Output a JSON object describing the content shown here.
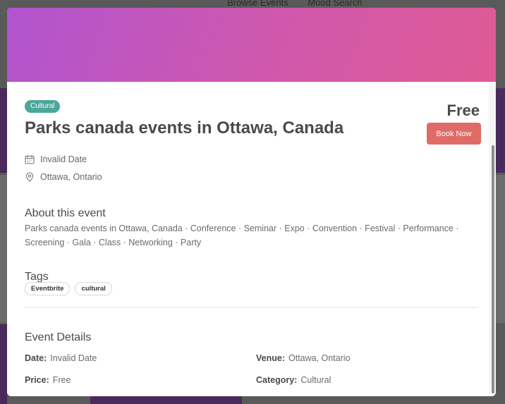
{
  "background": {
    "nav_items": [
      "Browse Events",
      "Mood Search"
    ]
  },
  "modal": {
    "category_badge": "Cultural",
    "title": "Parks canada events in Ottawa, Canada",
    "price": "Free",
    "book_button": "Book Now",
    "date": "Invalid Date",
    "location": "Ottawa, Ontario",
    "about_heading": "About this event",
    "about_text": "Parks canada events in Ottawa, Canada · Conference · Seminar · Expo · Convention · Festival · Performance · Screening · Gala · Class · Networking · Party",
    "tags_heading": "Tags",
    "tags": [
      "Eventbrite",
      "cultural"
    ],
    "details_heading": "Event Details",
    "details": {
      "date_label": "Date:",
      "date_value": "Invalid Date",
      "venue_label": "Venue:",
      "venue_value": "Ottawa, Ontario",
      "price_label": "Price:",
      "price_value": "Free",
      "category_label": "Category:",
      "category_value": "Cultural"
    }
  },
  "colors": {
    "badge": "#4aa79a",
    "book_button": "#e06b66",
    "hero_gradient": [
      "#b154cf",
      "#de5a94"
    ]
  }
}
